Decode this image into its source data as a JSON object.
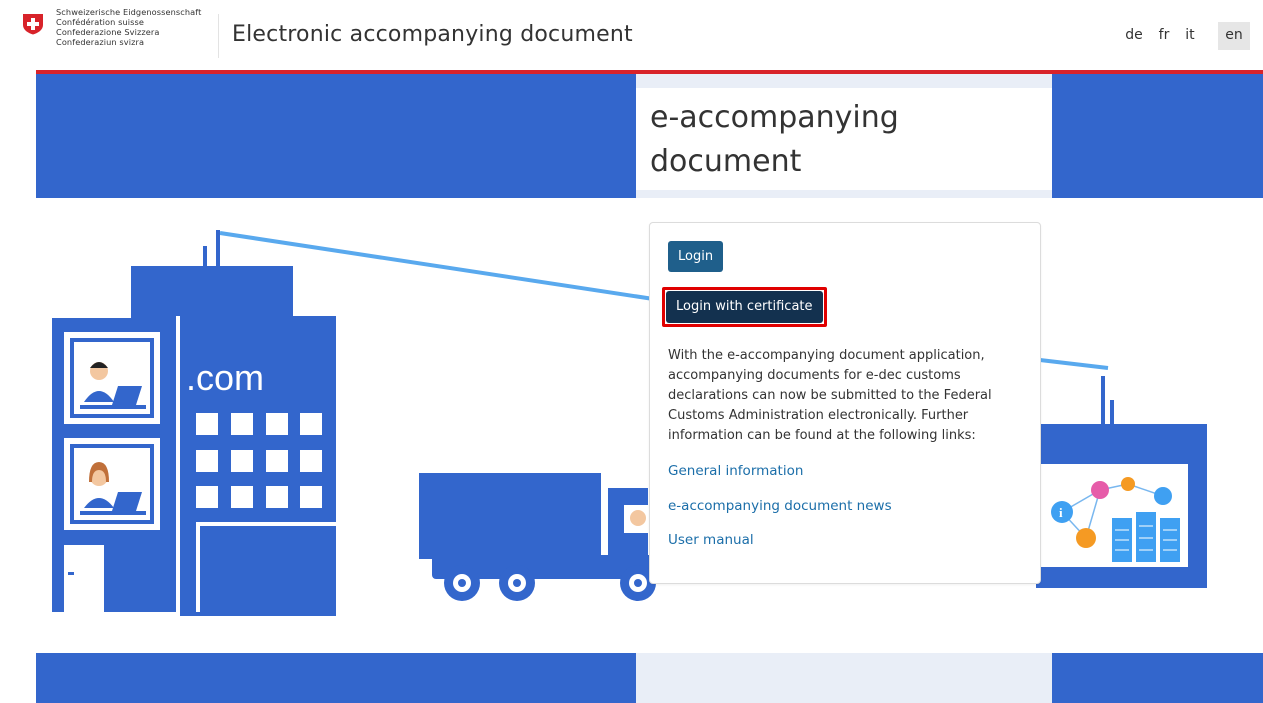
{
  "header": {
    "gov_names": [
      "Schweizerische Eidgenossenschaft",
      "Confédération suisse",
      "Confederazione Svizzera",
      "Confederaziun svizra"
    ],
    "app_title": "Electronic accompanying document",
    "languages": [
      "de",
      "fr",
      "it",
      "en"
    ],
    "active_language": "en"
  },
  "banner": {
    "title": "e-accompanying document"
  },
  "illustration": {
    "building_sign": ".com"
  },
  "login_card": {
    "login_label": "Login",
    "cert_login_label": "Login with certificate",
    "description": "With the e-accompanying document application, accompanying documents for e-dec customs declarations can now be submitted to the Federal Customs Administration electronically. Further information can be found at the following links:",
    "links": [
      "General information",
      "e-accompanying document news",
      "User manual"
    ]
  },
  "colors": {
    "brand_blue": "#3366cc",
    "accent_red": "#d8232a",
    "login_button": "#1f5f8b",
    "cert_button": "#13314f",
    "link": "#1b6ea9"
  }
}
